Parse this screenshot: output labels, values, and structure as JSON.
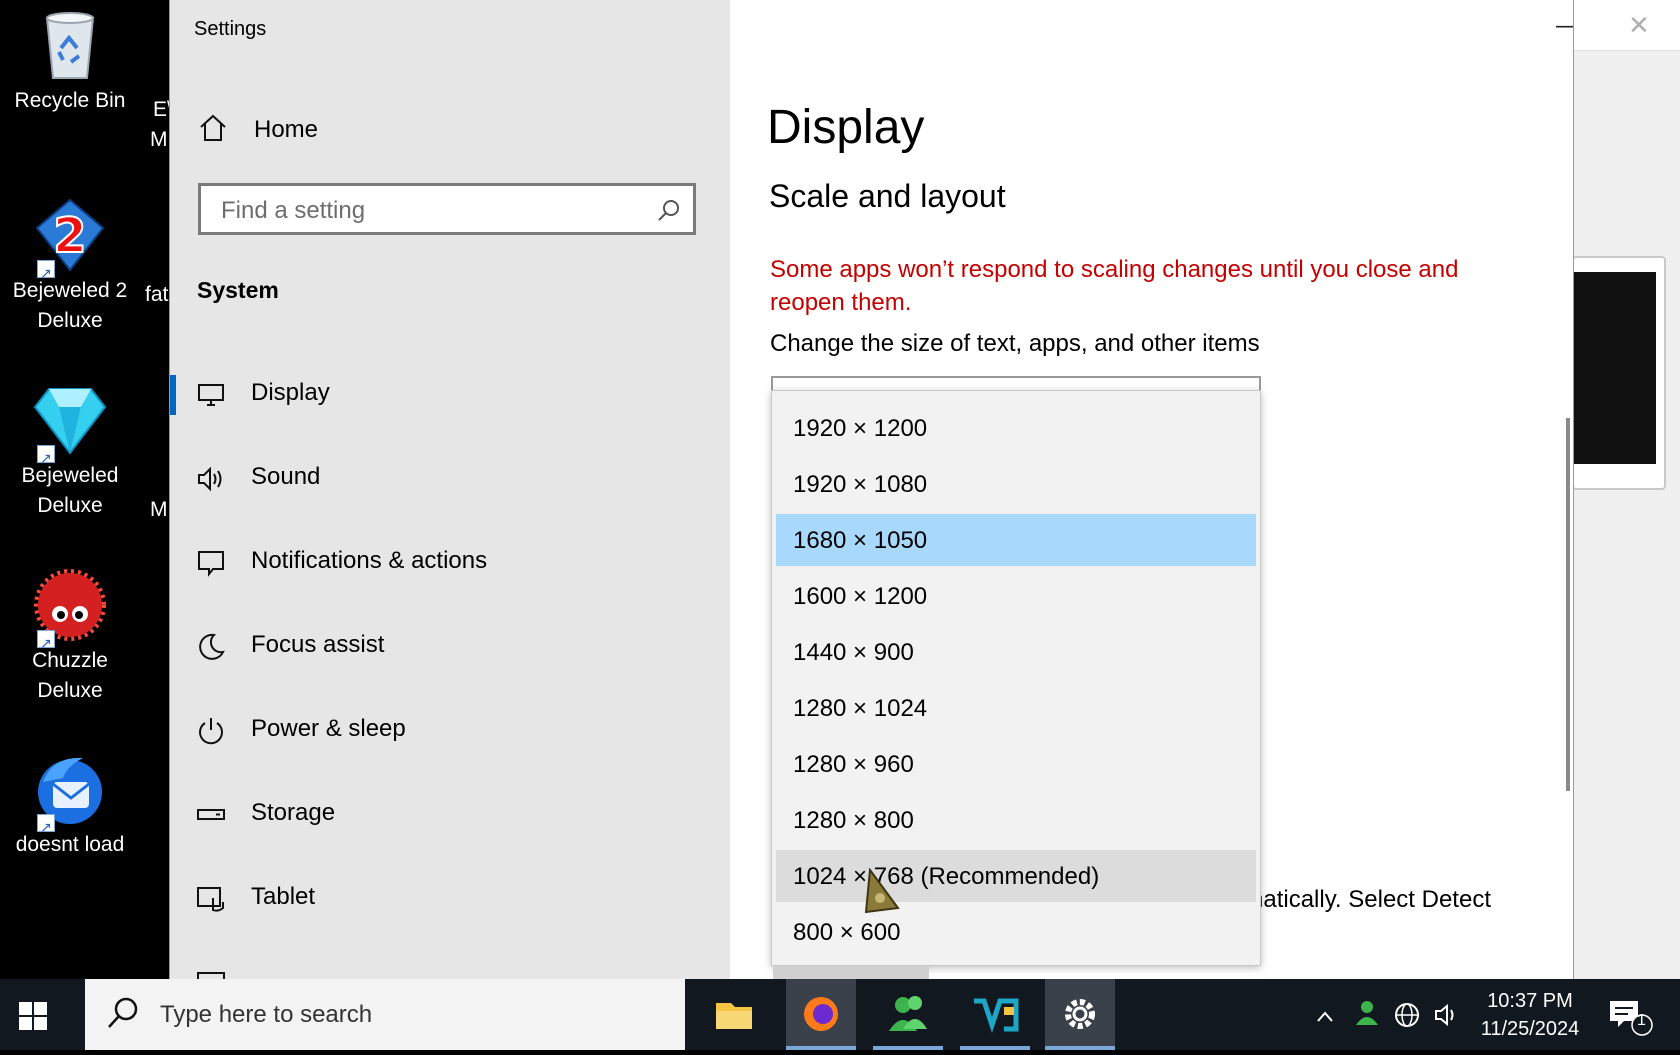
{
  "desktop": {
    "icons": [
      {
        "name": "recycle-bin",
        "label": "Recycle Bin"
      },
      {
        "name": "bejeweled-2-deluxe",
        "label": "Bejeweled 2 Deluxe"
      },
      {
        "name": "bejeweled-deluxe",
        "label": "Bejeweled Deluxe"
      },
      {
        "name": "chuzzle-deluxe",
        "label": "Chuzzle Deluxe"
      },
      {
        "name": "doesnt-load",
        "label": "doesnt load"
      }
    ],
    "partial_labels": [
      "E\\",
      "M",
      "fat",
      "M"
    ]
  },
  "window": {
    "title": "Settings",
    "controls": {
      "minimize": "—",
      "maximize": "☐",
      "close": "✕"
    }
  },
  "sidebar": {
    "home_label": "Home",
    "search_placeholder": "Find a setting",
    "section": "System",
    "items": [
      {
        "label": "Display",
        "icon": "monitor-icon",
        "active": true
      },
      {
        "label": "Sound",
        "icon": "speaker-icon"
      },
      {
        "label": "Notifications & actions",
        "icon": "notification-icon"
      },
      {
        "label": "Focus assist",
        "icon": "moon-icon"
      },
      {
        "label": "Power & sleep",
        "icon": "power-icon"
      },
      {
        "label": "Storage",
        "icon": "storage-icon"
      },
      {
        "label": "Tablet",
        "icon": "tablet-icon"
      }
    ]
  },
  "main": {
    "title": "Display",
    "subtitle": "Scale and layout",
    "warning": "Some apps won’t respond to scaling changes until you close and reopen them.",
    "change_label": "Change the size of text, apps, and other items",
    "behind_text": "omatically. Select Detect"
  },
  "resolution_dropdown": {
    "options": [
      "1920 × 1200",
      "1920 × 1080",
      "1680 × 1050",
      "1600 × 1200",
      "1440 × 900",
      "1280 × 1024",
      "1280 × 960",
      "1280 × 800",
      "1024 × 768 (Recommended)",
      "800 × 600"
    ],
    "selected": "1680 × 1050",
    "hovered": "1024 × 768 (Recommended)"
  },
  "taskbar": {
    "search_placeholder": "Type here to search",
    "time": "10:37 PM",
    "date": "11/25/2024",
    "notification_count": "1"
  },
  "colors": {
    "accent": "#0067c0",
    "selected_item": "#a8d8fb",
    "warning_text": "#c50000"
  }
}
